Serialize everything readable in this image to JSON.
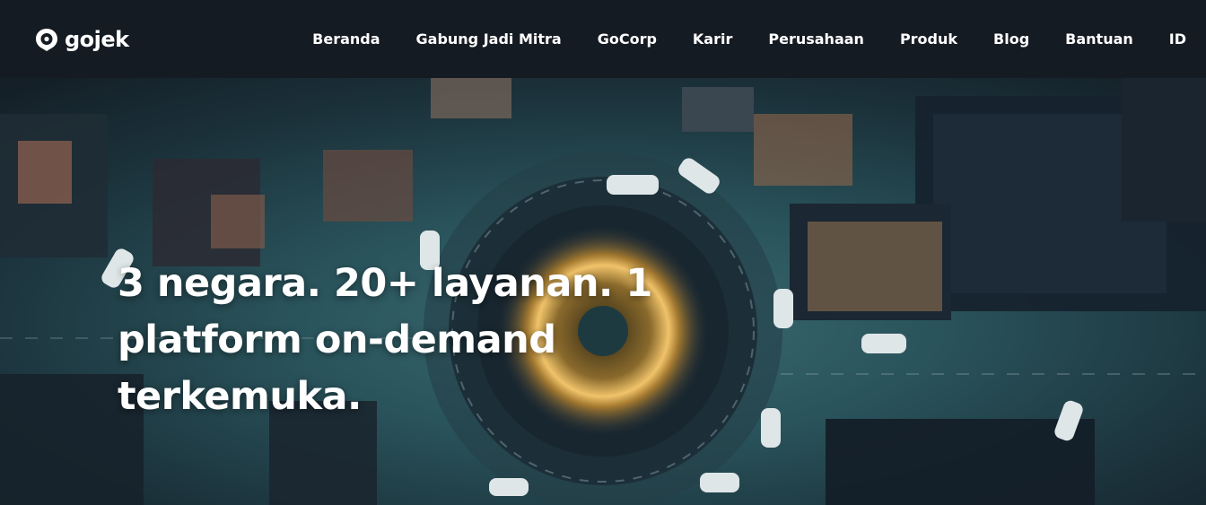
{
  "brand": {
    "name": "gojek",
    "logo_icon": "gojek-logo-icon"
  },
  "nav": {
    "items": [
      {
        "label": "Beranda"
      },
      {
        "label": "Gabung Jadi Mitra"
      },
      {
        "label": "GoCorp"
      },
      {
        "label": "Karir"
      },
      {
        "label": "Perusahaan"
      },
      {
        "label": "Produk"
      },
      {
        "label": "Blog"
      },
      {
        "label": "Bantuan"
      },
      {
        "label": "ID"
      }
    ]
  },
  "hero": {
    "headline": "3 negara. 20+ layanan. 1 platform on-demand terkemuka."
  },
  "colors": {
    "nav_bg": "#151b22",
    "text": "#ffffff"
  }
}
